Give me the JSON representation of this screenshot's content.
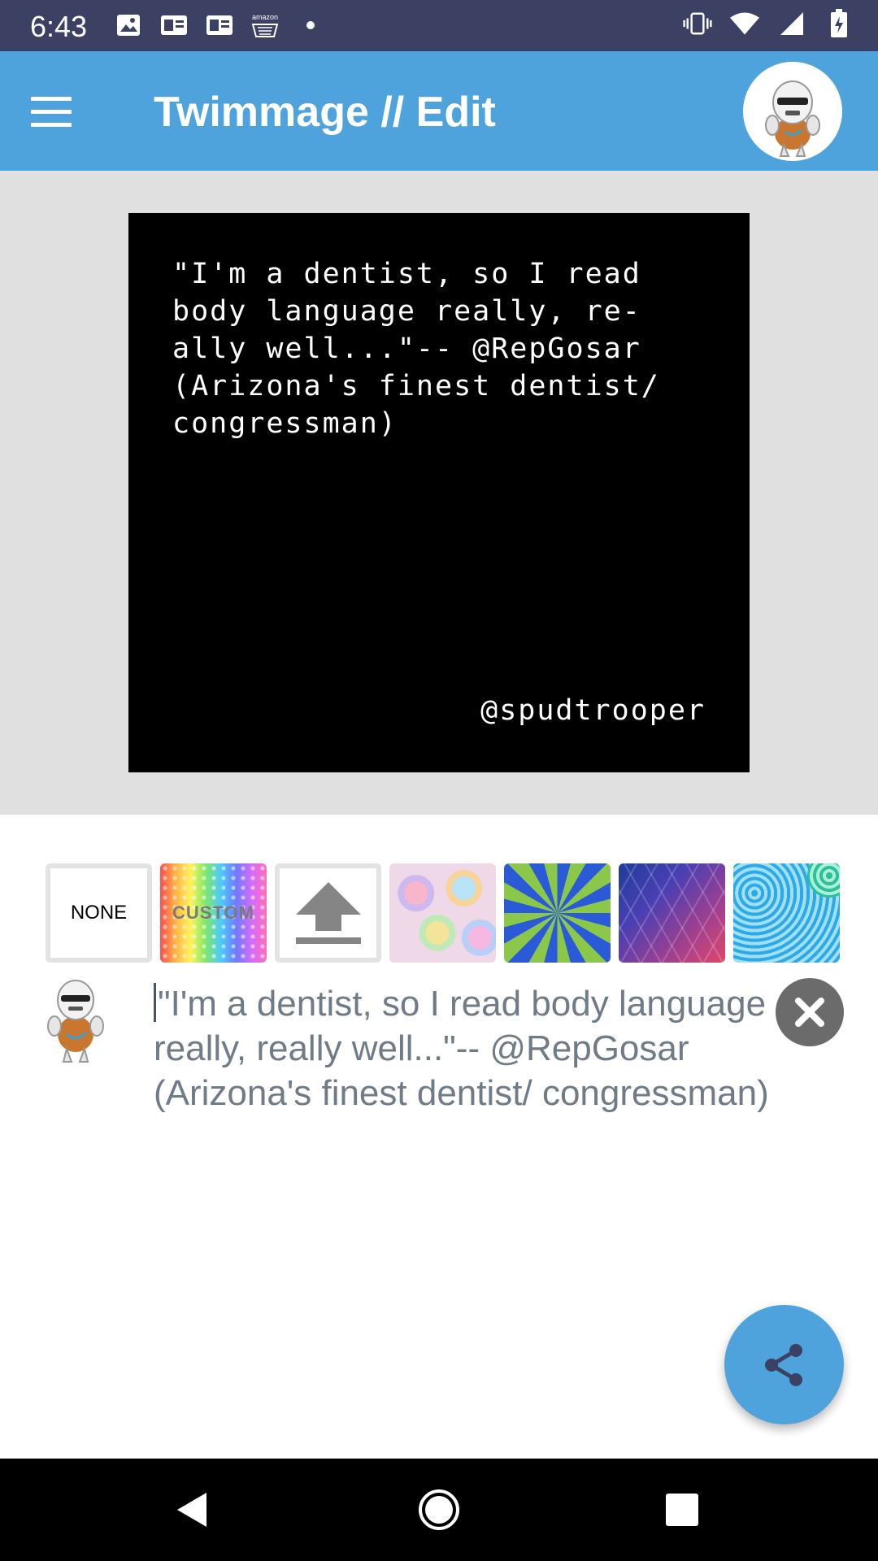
{
  "status_bar": {
    "time": "6:43",
    "left_icons": [
      "image-icon",
      "gallery-icon",
      "gallery-icon",
      "amazon-icon",
      "dot-icon"
    ],
    "right_icons": [
      "vibrate-icon",
      "wifi-icon",
      "signal-icon",
      "battery-icon"
    ]
  },
  "app_bar": {
    "title": "Twimmage // Edit",
    "menu_icon": "menu-icon",
    "avatar": "profile-avatar"
  },
  "preview": {
    "text": "\"I'm a dentist, so I read\nbody language really, re-\nally well...\"-- @RepGosar\n(Arizona's finest dentist/\ncongressman)",
    "handle": "@spudtrooper",
    "background_color": "#000000",
    "text_color": "#ffffff"
  },
  "backgrounds": {
    "none_label": "NONE",
    "custom_label": "CUSTOM",
    "upload_icon": "upload-icon",
    "patterns": [
      "pastel-swirls",
      "blue-green-spiral",
      "geometric-gradient",
      "blue-swirls"
    ]
  },
  "composer": {
    "text": "\"I'm a dentist, so I read body language really, really well...\"-- @RepGosar (Arizona's finest dentist/ congressman)",
    "clear_icon": "close-icon"
  },
  "fab": {
    "icon": "share-icon"
  },
  "nav_bar": {
    "icons": [
      "back-icon",
      "home-icon",
      "recents-icon"
    ]
  },
  "colors": {
    "status_bar": "#3c4164",
    "app_bar": "#4fa3dc",
    "preview_bg": "#e0e0e0",
    "fab": "#4fa3dc"
  }
}
